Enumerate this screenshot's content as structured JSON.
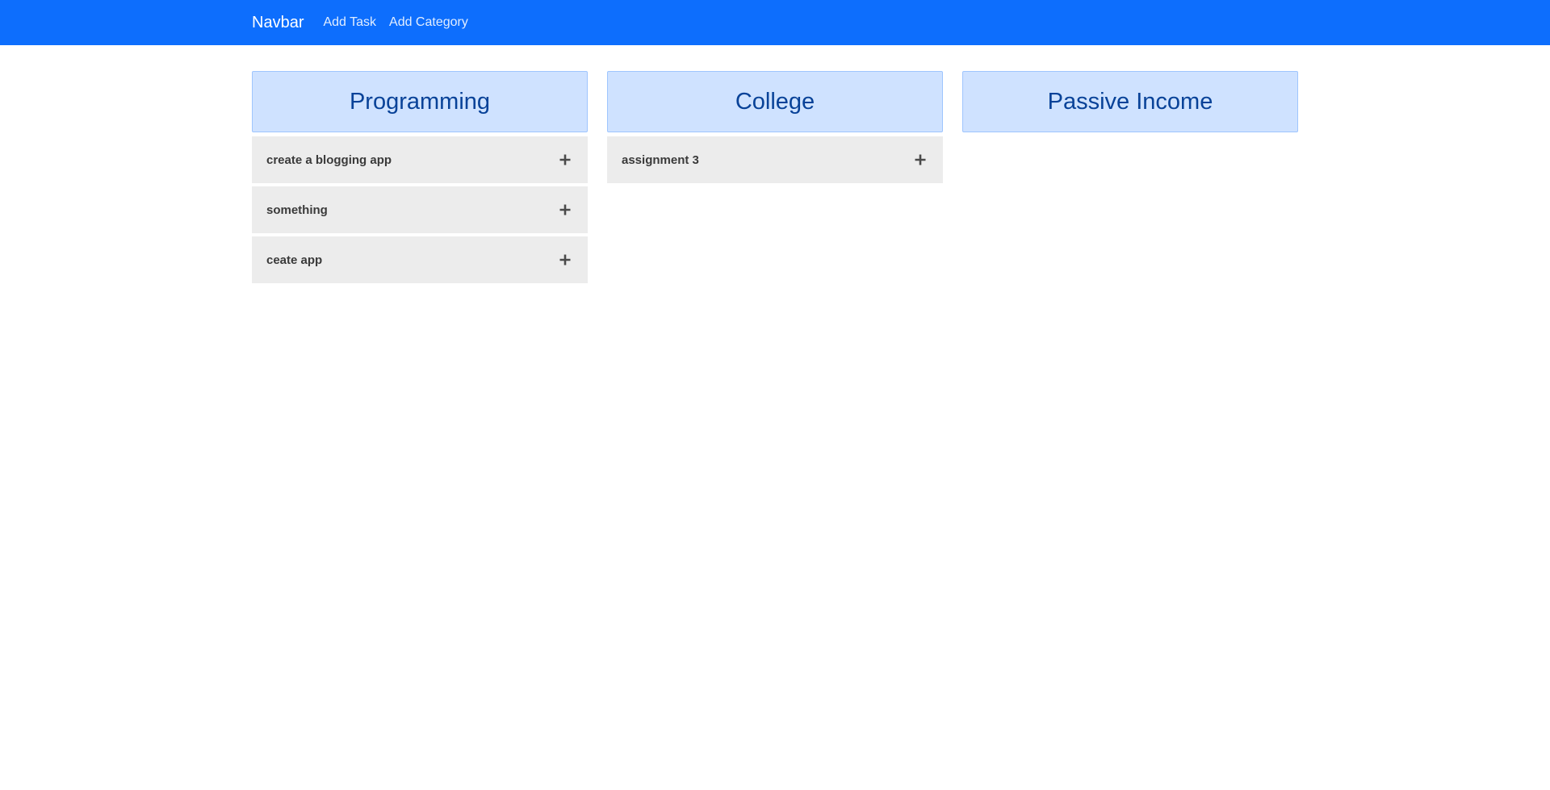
{
  "navbar": {
    "brand": "Navbar",
    "links": [
      "Add Task",
      "Add Category"
    ]
  },
  "categories": [
    {
      "title": "Programming",
      "tasks": [
        "create a blogging app",
        "something",
        "ceate app"
      ]
    },
    {
      "title": "College",
      "tasks": [
        "assignment 3"
      ]
    },
    {
      "title": "Passive Income",
      "tasks": []
    }
  ],
  "icons": {
    "task_action": "plus-icon"
  },
  "colors": {
    "navbar_bg": "#0d6efd",
    "category_header_bg": "#cfe2ff",
    "category_header_text": "#084298",
    "task_bg": "#ececec"
  }
}
